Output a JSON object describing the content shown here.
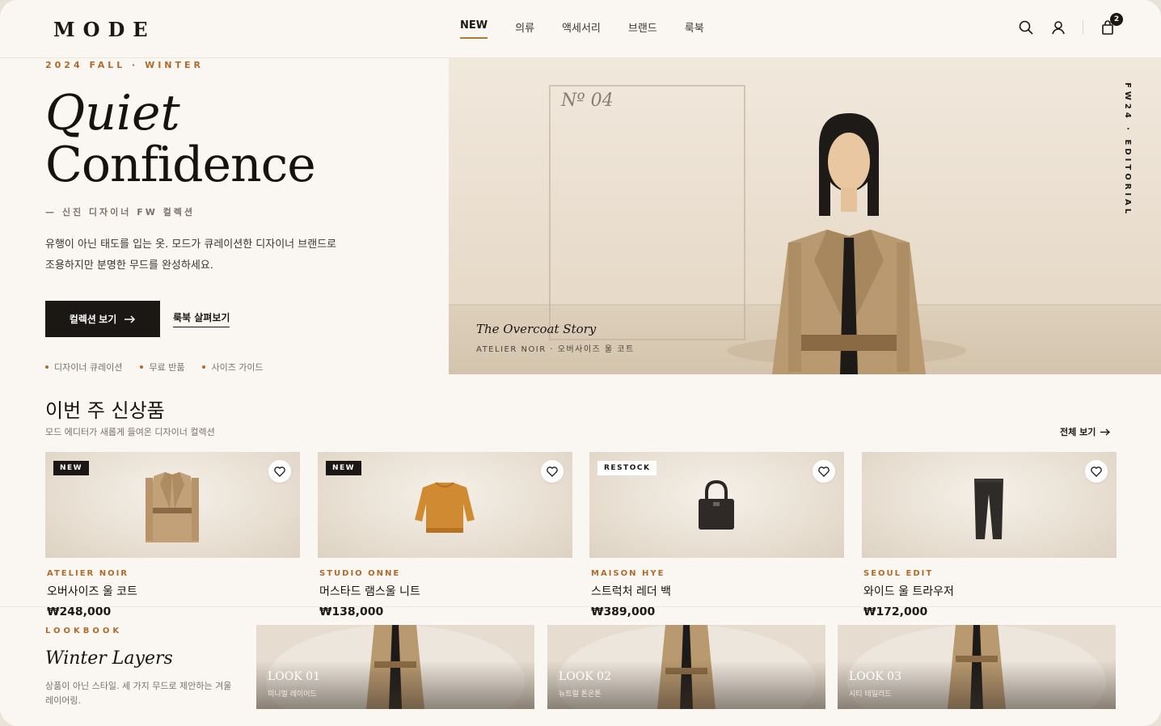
{
  "brand": {
    "logo": "MODE"
  },
  "nav": [
    {
      "label": "NEW",
      "active": true
    },
    {
      "label": "의류"
    },
    {
      "label": "액세서리"
    },
    {
      "label": "브랜드"
    },
    {
      "label": "룩북"
    }
  ],
  "header": {
    "cart_count": "2"
  },
  "hero": {
    "season": "2024 FALL · WINTER",
    "title_line1": "Quiet",
    "title_line2": "Confidence",
    "subtitle": "— 신진 디자이너 FW 컬렉션",
    "desc_line1": "유행이 아닌 태도를 입는 옷. 모드가 큐레이션한 디자이너 브랜드로",
    "desc_line2": "조용하지만 분명한 무드를 완성하세요.",
    "cta_primary": "컬렉션 보기",
    "cta_secondary": "룩북 살펴보기",
    "perks": [
      "디자이너 큐레이션",
      "무료 반품",
      "사이즈 가이드"
    ],
    "image": {
      "vertical_label": "FW24 · EDITORIAL",
      "number": "Nº 04",
      "story_title": "The Overcoat Story",
      "story_sub": "ATELIER NOIR · 오버사이즈 울 코트"
    }
  },
  "arrivals": {
    "title": "이번 주 신상품",
    "subtitle": "모드 에디터가 새롭게 들여온 디자이너 컬렉션",
    "view_all": "전체 보기",
    "items": [
      {
        "badge": "NEW",
        "brand": "ATELIER NOIR",
        "name": "오버사이즈 울 코트",
        "price": "₩248,000"
      },
      {
        "badge": "NEW",
        "brand": "STUDIO ONNE",
        "name": "머스타드 램스울 니트",
        "price": "₩138,000"
      },
      {
        "badge": "RESTOCK",
        "brand": "MAISON HYE",
        "name": "스트럭처 레더 백",
        "price": "₩389,000"
      },
      {
        "badge": "",
        "brand": "SEOUL EDIT",
        "name": "와이드 울 트라우저",
        "price": "₩172,000"
      }
    ]
  },
  "lookbook": {
    "label": "LOOKBOOK",
    "title": "Winter Layers",
    "desc": "상품이 아닌 스타일. 세 가지 무드로 제안하는 겨울 레이어링.",
    "looks": [
      {
        "title": "LOOK 01",
        "sub": "미니멀 레이어드"
      },
      {
        "title": "LOOK 02",
        "sub": "뉴트럴 톤온톤"
      },
      {
        "title": "LOOK 03",
        "sub": "시티 테일러드"
      }
    ]
  },
  "colors": {
    "accent": "#b06a2a",
    "dark": "#1a1714",
    "bg": "#faf7f2"
  }
}
